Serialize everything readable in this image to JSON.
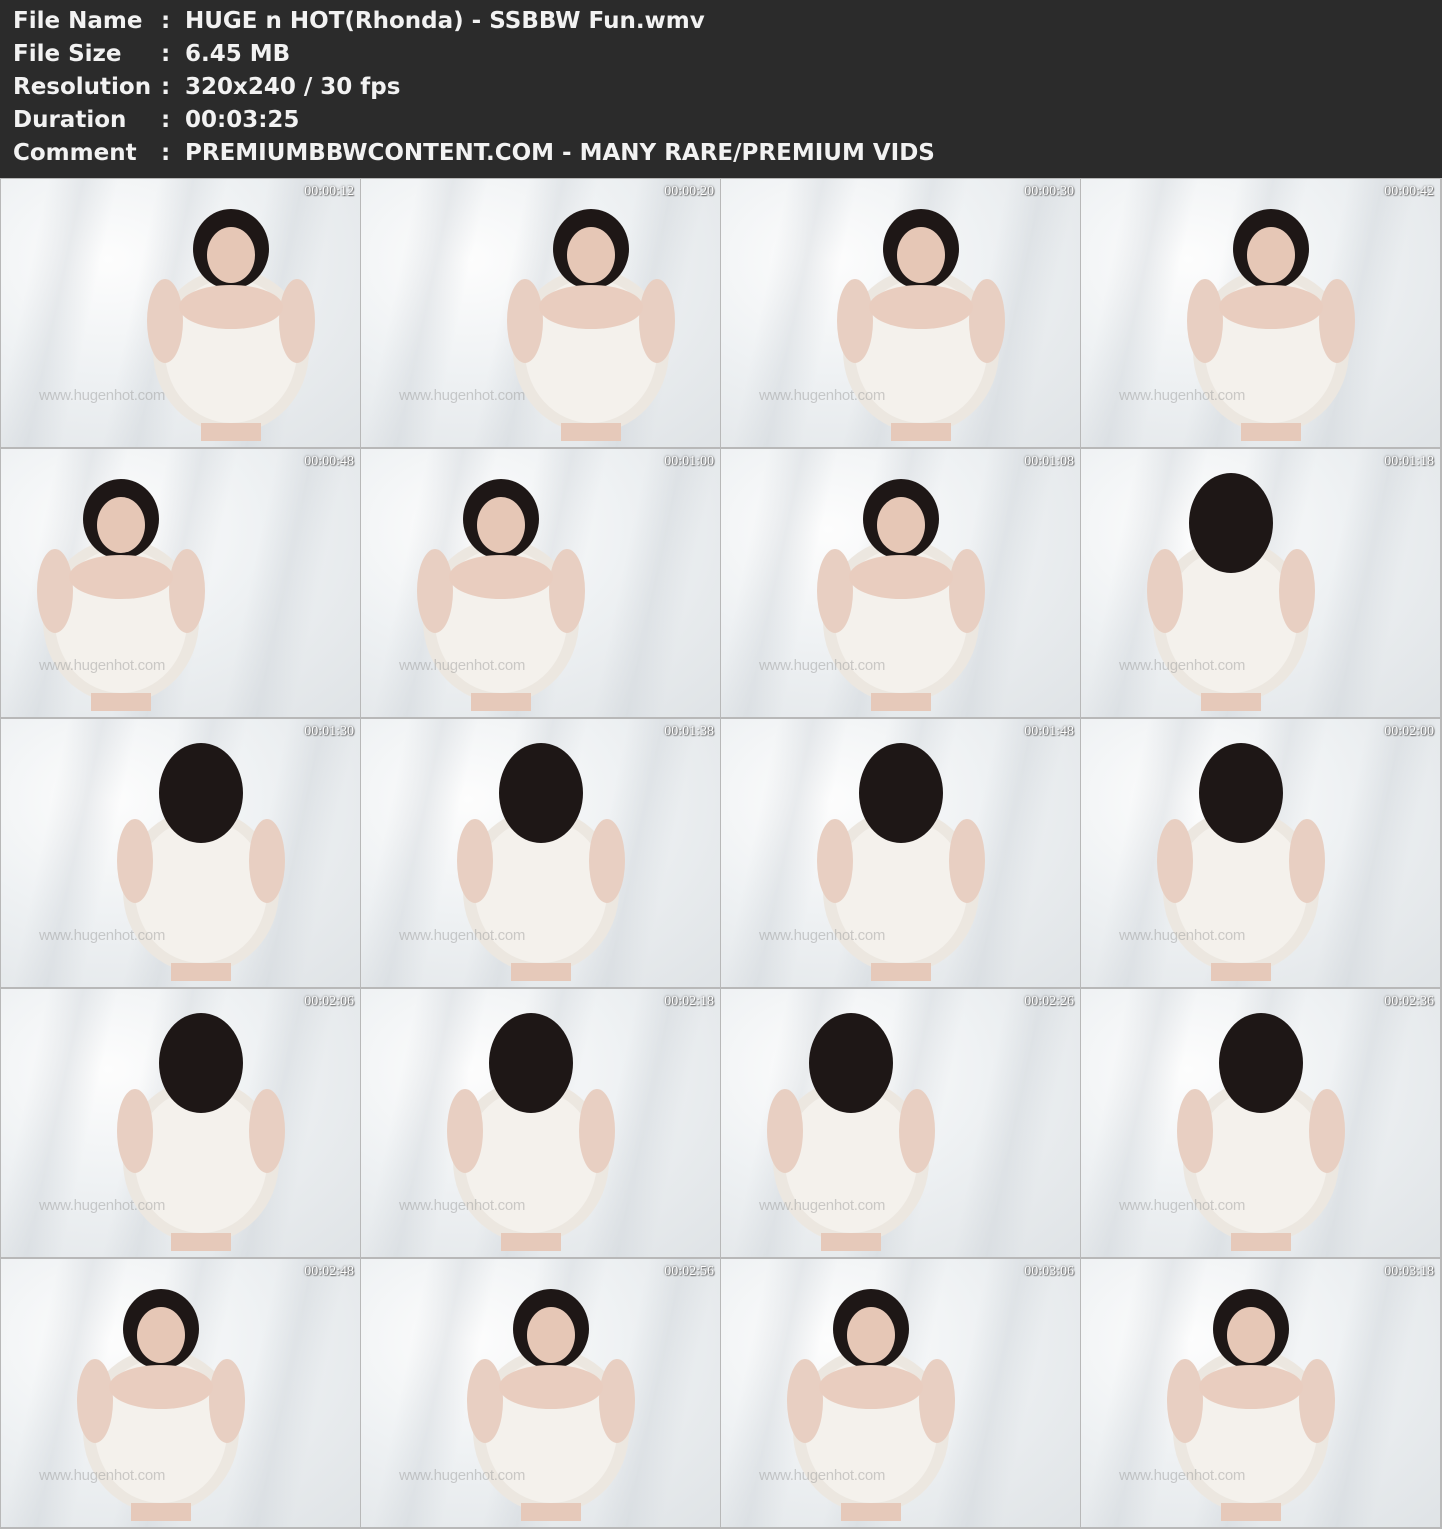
{
  "info": {
    "rows": [
      {
        "label": "File Name",
        "colon": ":",
        "value": "HUGE n HOT(Rhonda) - SSBBW Fun.wmv"
      },
      {
        "label": "File Size",
        "colon": ":",
        "value": "6.45 MB"
      },
      {
        "label": "Resolution",
        "colon": ":",
        "value": "320x240 / 30 fps"
      },
      {
        "label": "Duration",
        "colon": ":",
        "value": "00:03:25"
      },
      {
        "label": "Comment",
        "colon": ":",
        "value": "PREMIUMBBWCONTENT.COM - MANY RARE/PREMIUM VIDS"
      }
    ]
  },
  "thumbnails": {
    "watermark": "www.hugenhot.com",
    "timestamps": [
      "00:00:12",
      "00:00:20",
      "00:00:30",
      "00:00:42",
      "00:00:48",
      "00:01:00",
      "00:01:08",
      "00:01:18",
      "00:01:30",
      "00:01:38",
      "00:01:48",
      "00:02:00",
      "00:02:06",
      "00:02:18",
      "00:02:26",
      "00:02:36",
      "00:02:48",
      "00:02:56",
      "00:03:06",
      "00:03:18"
    ]
  }
}
